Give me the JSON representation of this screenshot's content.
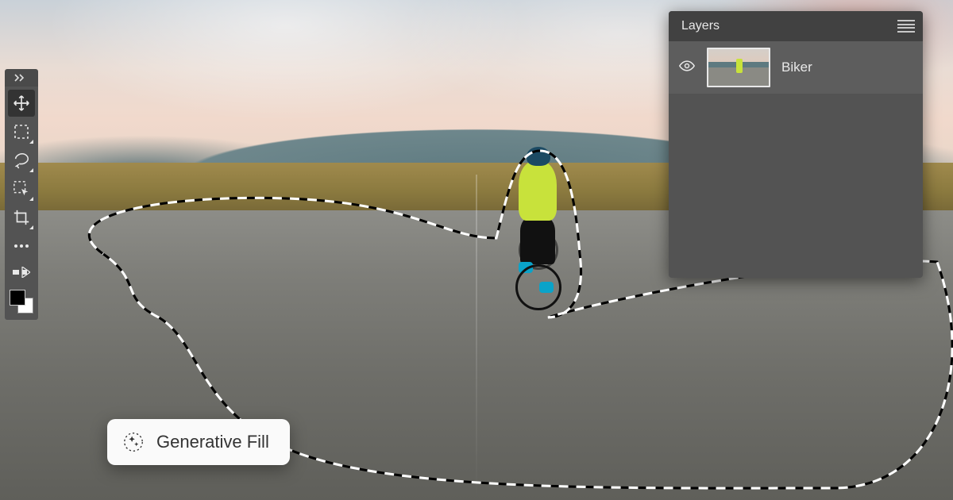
{
  "panels": {
    "layers": {
      "title": "Layers",
      "items": [
        {
          "name": "Biker",
          "visible": true
        }
      ]
    }
  },
  "toolbar": {
    "tools": [
      {
        "id": "move",
        "name": "move-tool",
        "selected": true
      },
      {
        "id": "marquee",
        "name": "rectangular-marquee-tool",
        "selected": false
      },
      {
        "id": "lasso",
        "name": "lasso-tool",
        "selected": false
      },
      {
        "id": "object-sel",
        "name": "object-selection-tool",
        "selected": false
      },
      {
        "id": "crop",
        "name": "crop-tool",
        "selected": false
      },
      {
        "id": "more",
        "name": "more-tools",
        "selected": false
      },
      {
        "id": "edit-tb",
        "name": "edit-toolbar",
        "selected": false
      }
    ],
    "foreground_color": "#000000",
    "background_color": "#ffffff"
  },
  "contextual_bar": {
    "generative_fill_label": "Generative Fill"
  },
  "canvas": {
    "subject": "cyclist on open road at sunset",
    "active_selection": "freeform lasso around pavement and cyclist"
  }
}
